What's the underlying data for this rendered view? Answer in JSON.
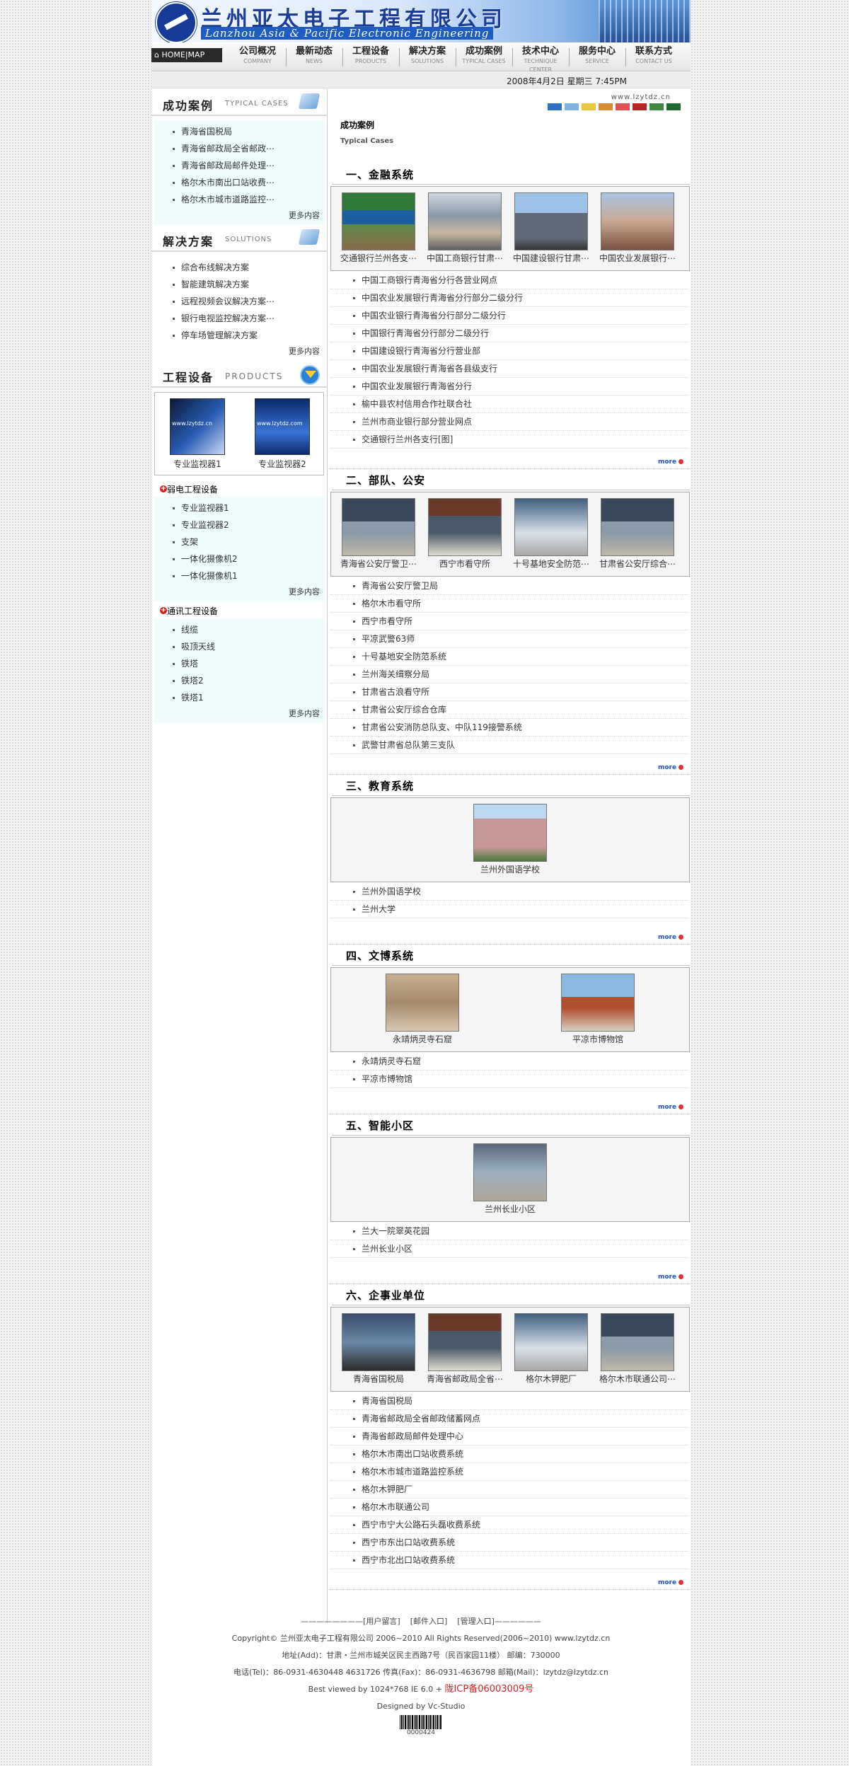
{
  "header": {
    "company_cn": "兰州亚太电子工程有限公司",
    "company_en": "Lanzhou Asia & Pacific Electronic Engineering",
    "home_label": "HOME|MAP",
    "nav": [
      {
        "cn": "公司概况",
        "en": "COMPANY"
      },
      {
        "cn": "最新动态",
        "en": "NEWS"
      },
      {
        "cn": "工程设备",
        "en": "PRODUCTS"
      },
      {
        "cn": "解决方案",
        "en": "SOLUTIONS"
      },
      {
        "cn": "成功案例",
        "en": "TYPICAL CASES"
      },
      {
        "cn": "技术中心",
        "en": "TECHNIQUE CENTER"
      },
      {
        "cn": "服务中心",
        "en": "SERVICE"
      },
      {
        "cn": "联系方式",
        "en": "CONTACT US"
      }
    ],
    "date": "2008年4月2日  星期三  7:45PM",
    "site_url": "www.lzytdz.cn",
    "swatch_colors": [
      "#2f6fc4",
      "#7fb2e5",
      "#e8c840",
      "#d88a30",
      "#e05050",
      "#c02020",
      "#3f8a3f",
      "#1f6a2f"
    ]
  },
  "sidebar": {
    "cases": {
      "title_cn": "成功案例",
      "title_en": "TYPICAL CASES",
      "items": [
        "青海省国税局",
        "青海省邮政局全省邮政⋯",
        "青海省邮政局邮件处理⋯",
        "格尔木市南出口站收费⋯",
        "格尔木市城市道路监控⋯"
      ],
      "more": "更多内容"
    },
    "solutions": {
      "title_cn": "解决方案",
      "title_en": "SOLUTIONS",
      "items": [
        "综合布线解决方案",
        "智能建筑解决方案",
        "远程视频会议解决方案⋯",
        "银行电视监控解决方案⋯",
        "停车场管理解决方案"
      ],
      "more": "更多内容"
    },
    "products": {
      "title_cn": "工程设备",
      "title_en": "PRODUCTS",
      "items": [
        {
          "name": "专业监视器1",
          "overlay": "www.lzytdz.cn"
        },
        {
          "name": "专业监视器2",
          "overlay": "www.lzytdz.com"
        }
      ]
    },
    "weak_current": {
      "title": "弱电工程设备",
      "items": [
        "专业监视器1",
        "专业监视器2",
        "支架",
        "一体化摄像机2",
        "一体化摄像机1"
      ],
      "more": "更多内容"
    },
    "telecom": {
      "title": "通讯工程设备",
      "items": [
        "线缆",
        "吸顶天线",
        "铁塔",
        "铁塔2",
        "铁塔1"
      ],
      "more": "更多内容"
    }
  },
  "main": {
    "title": "成功案例",
    "subtitle": "Typical Cases",
    "more_label": "more",
    "sections": [
      {
        "heading": "一、金融系统",
        "gallery": [
          "交通银行兰州各支⋯",
          "中国工商银行甘肃⋯",
          "中国建设银行甘肃⋯",
          "中国农业发展银行⋯"
        ],
        "links": [
          "中国工商银行青海省分行各营业网点",
          "中国农业发展银行青海省分行部分二级分行",
          "中国农业银行青海省分行部分二级分行",
          "中国银行青海省分行部分二级分行",
          "中国建设银行青海省分行营业部",
          "中国农业发展银行青海省各县级支行",
          "中国农业发展银行青海省分行",
          "榆中县农村信用合作社联合社",
          "兰州市商业银行部分营业网点",
          "交通银行兰州各支行[图]"
        ]
      },
      {
        "heading": "二、部队、公安",
        "gallery": [
          "青海省公安厅警卫⋯",
          "西宁市看守所",
          "十号基地安全防范⋯",
          "甘肃省公安厅综合⋯"
        ],
        "links": [
          "青海省公安厅警卫局",
          "格尔木市看守所",
          "西宁市看守所",
          "平凉武警63师",
          "十号基地安全防范系统",
          "兰州海关缉察分局",
          "甘肃省古浪看守所",
          "甘肃省公安厅综合仓库",
          "甘肃省公安消防总队支、中队119接警系统",
          "武警甘肃省总队第三支队"
        ]
      },
      {
        "heading": "三、教育系统",
        "gallery": [
          "兰州外国语学校"
        ],
        "links": [
          "兰州外国语学校",
          "兰州大学"
        ]
      },
      {
        "heading": "四、文博系统",
        "gallery": [
          "永靖炳灵寺石窟",
          "平凉市博物馆"
        ],
        "links": [
          "永靖炳灵寺石窟",
          "平凉市博物馆"
        ]
      },
      {
        "heading": "五、智能小区",
        "gallery": [
          "兰州长业小区"
        ],
        "links": [
          "兰大一院翠英花园",
          "兰州长业小区"
        ]
      },
      {
        "heading": "六、企事业单位",
        "gallery": [
          "青海省国税局",
          "青海省邮政局全省⋯",
          "格尔木钾肥厂",
          "格尔木市联通公司⋯"
        ],
        "links": [
          "青海省国税局",
          "青海省邮政局全省邮政储蓄网点",
          "青海省邮政局邮件处理中心",
          "格尔木市南出口站收费系统",
          "格尔木市城市道路监控系统",
          "格尔木钾肥厂",
          "格尔木市联通公司",
          "西宁市宁大公路石头磊收费系统",
          "西宁市东出口站收费系统",
          "西宁市北出口站收费系统"
        ]
      }
    ]
  },
  "footer": {
    "dashes_left": "————————",
    "guestbook": "[用户留言]",
    "mail": "[邮件入口]",
    "admin": "[管理入口]",
    "dashes_right": "——————",
    "copyright": "Copyright© 兰州亚太电子工程有限公司 2006~2010 All Rights Reserved(2006~2010)   www.lzytdz.cn",
    "address": "地址(Add)：甘肃・兰州市城关区民主西路7号（民百家园11楼）   邮编：730000",
    "contact": "电话(Tel)：86-0931-4630448   4631726   传真(Fax)：86-0931-4636798   邮箱(Mail)：lzytdz@lzytdz.cn",
    "best_viewed": "Best viewed by 1024*768  IE 6.0 + ",
    "icp": "陇ICP备06003009号",
    "designed_by": "Designed by Vc-Studio",
    "counter": "0000424"
  }
}
